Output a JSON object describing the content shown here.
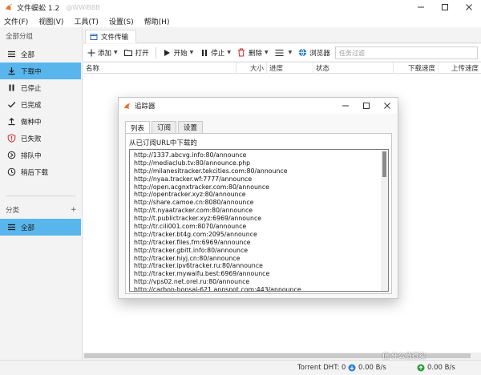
{
  "app": {
    "title": "文件蜈蚣 1.2",
    "title_extra": "@WWIBBB",
    "accent": "#59b6ec"
  },
  "menu": [
    "文件(F)",
    "视图(V)",
    "工具(T)",
    "设置(S)",
    "帮助(H)"
  ],
  "sidebar": {
    "groups_heading": "全部分组",
    "items": [
      {
        "label": "全部",
        "icon": "list-icon"
      },
      {
        "label": "下载中",
        "icon": "download-icon",
        "active": true
      },
      {
        "label": "已停止",
        "icon": "pause-icon"
      },
      {
        "label": "已完成",
        "icon": "check-icon"
      },
      {
        "label": "做种中",
        "icon": "upload-icon"
      },
      {
        "label": "已失败",
        "icon": "error-icon"
      },
      {
        "label": "排队中",
        "icon": "queue-icon"
      },
      {
        "label": "稍后下载",
        "icon": "clock-icon"
      }
    ],
    "category_heading": "分类",
    "add_label": "+",
    "category_items": [
      {
        "label": "全部",
        "icon": "list-icon",
        "active": true
      }
    ]
  },
  "tab": {
    "label": "文件传输"
  },
  "toolbar": {
    "add": "添加",
    "open": "打开",
    "start": "开始",
    "stop": "停止",
    "delete": "删除",
    "browser": "浏览器",
    "filter_placeholder": "任务过滤"
  },
  "table": {
    "columns": [
      "名称",
      "大小",
      "进度",
      "状态",
      "下载速度",
      "上传速度"
    ]
  },
  "statusbar": {
    "dht": "Torrent DHT:  0",
    "down": "0.00 B/s",
    "up": "0.00 B/s"
  },
  "dialog": {
    "title": "追踪器",
    "tabs": [
      "列表",
      "订阅",
      "设置"
    ],
    "description": "从已订阅URL中下载的",
    "trackers": [
      "http://1337.abcvg.info:80/announce",
      "http://mediaclub.tv:80/announce.php",
      "http://milanesitracker.tekcities.com:80/announce",
      "http://nyaa.tracker.wf:7777/announce",
      "http://open.acgnxtracker.com:80/announce",
      "http://opentracker.xyz:80/announce",
      "http://share.camoe.cn:8080/announce",
      "http://t.nyaatracker.com:80/announce",
      "http://t.publictracker.xyz:6969/announce",
      "http://tr.cili001.com:8070/announce",
      "http://tracker.bt4g.com:2095/announce",
      "http://tracker.files.fm:6969/announce",
      "http://tracker.gbitt.info:80/announce",
      "http://tracker.hiyj.cn:80/announce",
      "http://tracker.ipv6tracker.ru:80/announce",
      "http://tracker.mywaifu.best:6969/announce",
      "http://vps02.net.orel.ru:80/announce",
      "http://carbon-bonsai-621.appspot.com:443/announce"
    ]
  },
  "watermark": "值 什么值得买"
}
